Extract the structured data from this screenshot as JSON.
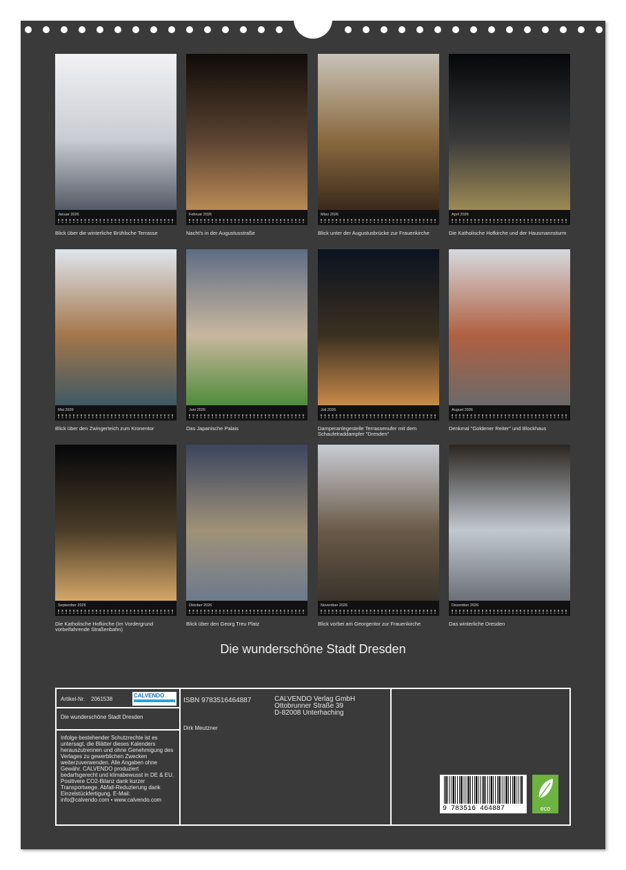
{
  "months": [
    {
      "label": "Januar 2026",
      "caption": "Blick über die winterliche Brühlsche Terrasse",
      "colors": [
        "#f2f2f4",
        "#c9ccd2",
        "#555a66"
      ]
    },
    {
      "label": "Februar 2026",
      "caption": "Nacht's in der Augustusstraße",
      "colors": [
        "#0f0b08",
        "#5a4330",
        "#b98a55"
      ]
    },
    {
      "label": "März 2026",
      "caption": "Blick unter der Augustusbrücke zur Frauenkirche",
      "colors": [
        "#c9c3b8",
        "#8a6a40",
        "#3b2a1a"
      ]
    },
    {
      "label": "April 2026",
      "caption": "Die Katholische Hofkirche und der Hausmannsturm",
      "colors": [
        "#05070a",
        "#3a3a3a",
        "#9c8a55"
      ]
    },
    {
      "label": "Mai 2026",
      "caption": "Blick über den Zwingerteich zum Kronentor",
      "colors": [
        "#dfe6ee",
        "#a4764a",
        "#3f5a64"
      ]
    },
    {
      "label": "Juni 2026",
      "caption": "Das Japanische Palais",
      "colors": [
        "#5d6d84",
        "#c9b79e",
        "#4f8c3a"
      ]
    },
    {
      "label": "Juli 2026",
      "caption": "Damperanlegestelle Terrassenufer mit dem Schaufelraddampfer \"Dresden\"",
      "colors": [
        "#0b1220",
        "#3a3020",
        "#c98a4a"
      ]
    },
    {
      "label": "August 2026",
      "caption": "Denkmal \"Goldener Reiter\" und Blockhaus",
      "colors": [
        "#d6dae0",
        "#b06040",
        "#6a6a6a"
      ]
    },
    {
      "label": "September 2026",
      "caption": "Die Katholische Hofkirche (Im Vordergrund vorbeifahrende Straßenbahn)",
      "colors": [
        "#05060a",
        "#4a3c28",
        "#d5a868"
      ]
    },
    {
      "label": "Oktober 2026",
      "caption": "Blick über den Georg Treu Platz",
      "colors": [
        "#3b4560",
        "#a09278",
        "#6b7a8e"
      ]
    },
    {
      "label": "November 2026",
      "caption": "Blick vorbei am Georgentor zur Frauenkirche",
      "colors": [
        "#c8ccd4",
        "#6a5a48",
        "#3a342c"
      ]
    },
    {
      "label": "Dezember 2026",
      "caption": "Das winterliche Dresden",
      "colors": [
        "#2a2520",
        "#c2c8d0",
        "#6b7078"
      ]
    }
  ],
  "title": "Die wunderschöne Stadt Dresden",
  "info": {
    "article_label": "Artikel-Nr.",
    "article_no": "2061538",
    "logo_text": "CALVENDO",
    "calendar_title": "Die wunderschöne Stadt Dresden",
    "legal_text": "Infolge bestehender Schutzrechte ist es untersagt, die Blätter dieses Kalenders herauszutrennen und ohne Genehmigung des Verlages zu gewerblichen Zwecken weiterzuverwenden. Alle Angaben ohne Gewähr. CALVENDO produziert bedarfsgerecht und klimabewusst in DE & EU. Positivere CO2-Bilanz dank kurzer Transportwege. Abfall-Reduzierung dank Einzelstückfertigung. E-Mail: info@calvendo.com • www.calvendo.com",
    "isbn": "ISBN 9783516464887",
    "author": "Dirk Meutzner",
    "publisher_lines": [
      "CALVENDO Verlag GmbH",
      "Ottobrunner Straße 39",
      "D-82008 Unterhaching"
    ],
    "barcode_number": "9 783516 464887",
    "eco_label": "eco"
  }
}
